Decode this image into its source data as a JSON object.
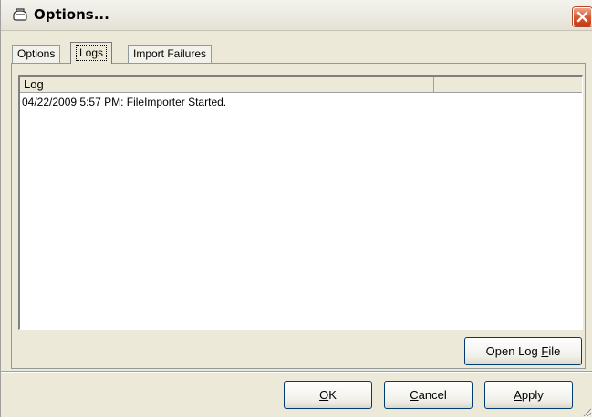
{
  "window": {
    "title": "Options...",
    "icon": "options-dialog-icon",
    "close_icon": "close-icon"
  },
  "tabs": [
    {
      "label": "Options",
      "active": false
    },
    {
      "label": "Logs",
      "active": true
    },
    {
      "label": "Import Failures",
      "active": false
    }
  ],
  "log_list": {
    "columns": [
      "Log",
      ""
    ],
    "rows": [
      "04/22/2009 5:57 PM: FileImporter Started."
    ]
  },
  "buttons": {
    "open_log_file": {
      "text": "Open Log ",
      "accel": "F",
      "rest": "ile"
    },
    "ok": {
      "text": "",
      "accel": "O",
      "rest": "K"
    },
    "cancel": {
      "text": "",
      "accel": "C",
      "rest": "ancel"
    },
    "apply": {
      "text": "",
      "accel": "A",
      "rest": "pply"
    }
  },
  "colors": {
    "dialog_bg": "#ece9d8",
    "close_red": "#d9542f",
    "button_border": "#003c74"
  }
}
